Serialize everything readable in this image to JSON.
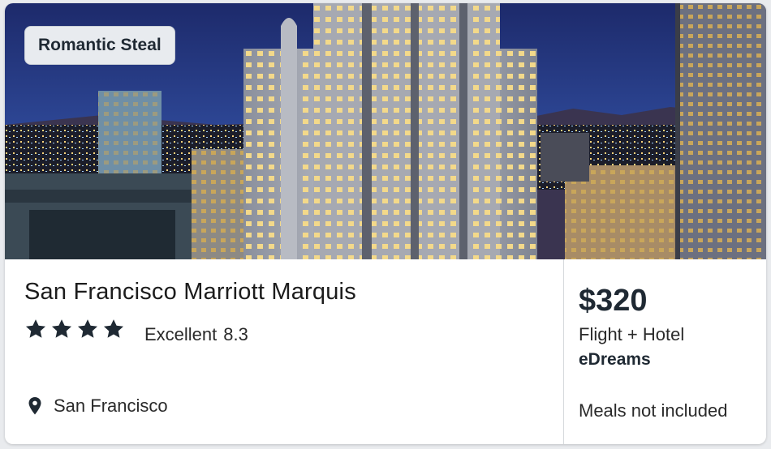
{
  "deal": {
    "badge": "Romantic Steal",
    "hotel_name": "San Francisco Marriott Marquis",
    "star_count": 4,
    "rating_label": "Excellent",
    "rating_score": "8.3",
    "location": "San Francisco",
    "price": "$320",
    "package_type": "Flight + Hotel",
    "provider": "eDreams",
    "meals": "Meals not included"
  },
  "icons": {
    "star": "star-icon",
    "pin": "map-pin-icon"
  }
}
